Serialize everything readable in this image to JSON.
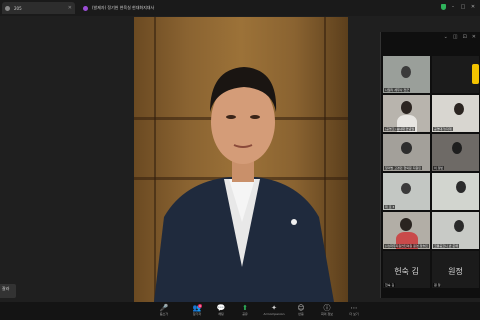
{
  "tabs": [
    {
      "label": "205",
      "color": "#8a8a8a"
    },
    {
      "label": "(발제자) 정기헌 현육실 현대화지대사",
      "color": "#9b4dd6"
    }
  ],
  "left_note": "잘라",
  "panel_header": [
    "⌄",
    "◫",
    "⊡",
    "✕"
  ],
  "participants": [
    {
      "label": "나일리 세무사 전군",
      "type": "photo"
    },
    {
      "label": "",
      "type": "yellow"
    },
    {
      "label": "(공명조) 송녀대 안녕월",
      "type": "photo"
    },
    {
      "label": "공명대가/자계",
      "type": "photo"
    },
    {
      "label": "알의법 고경민 협외문 지원민",
      "type": "photo"
    },
    {
      "label": "이 정빈",
      "type": "photo"
    },
    {
      "label": "테 로 3",
      "type": "photo"
    },
    {
      "label": "",
      "type": "photo"
    },
    {
      "label": "(사)파주지원연천의원 원영 정솔민",
      "type": "photo"
    },
    {
      "label": "코통공코니 반 준해",
      "type": "photo"
    },
    {
      "label": "헌숙 김",
      "type": "name"
    },
    {
      "label": "원정",
      "type": "name"
    }
  ],
  "participant_footer": [
    "헌숙 김",
    "원 정"
  ],
  "toolbar": [
    {
      "icon": "🎤",
      "label": "음소거",
      "name": "mute"
    },
    {
      "icon": "👥",
      "label": "참가자",
      "name": "participants",
      "badge": "9"
    },
    {
      "icon": "💬",
      "label": "채팅",
      "name": "chat"
    },
    {
      "icon": "⬆",
      "label": "공유",
      "name": "share",
      "green": true
    },
    {
      "icon": "✦",
      "label": "AI Companion",
      "name": "ai-companion"
    },
    {
      "icon": "☺",
      "label": "반응",
      "name": "reactions"
    },
    {
      "icon": "ⓘ",
      "label": "회의 정보",
      "name": "meeting-info"
    },
    {
      "icon": "⋯",
      "label": "더 보기",
      "name": "more"
    }
  ],
  "colors": {
    "accent": "#2fb35b",
    "badge": "#e0245e",
    "speaker": "#f2c300"
  }
}
